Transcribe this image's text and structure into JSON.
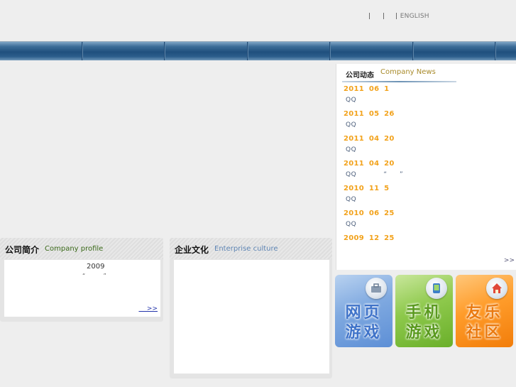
{
  "header": {
    "links": [
      "|",
      "|",
      "|"
    ],
    "english_label": "ENGLISH"
  },
  "nav": {
    "items": 7
  },
  "news": {
    "title_cn": "公司动态",
    "title_en": "Company News",
    "items": [
      {
        "date": "2011  06  1",
        "title": "QQ"
      },
      {
        "date": "2011  05  26",
        "title": "QQ"
      },
      {
        "date": "2011  04  20",
        "title": "QQ"
      },
      {
        "date": "2011  04  20",
        "title": "QQ           “     ”"
      },
      {
        "date": "2010  11  5",
        "title": "QQ"
      },
      {
        "date": "2010  06  25",
        "title": "QQ"
      },
      {
        "date": "2009  12  25",
        "title": ""
      }
    ],
    "more": ">>"
  },
  "tiles": [
    {
      "line1": "网页",
      "line2": "游戏",
      "icon": "briefcase-icon"
    },
    {
      "line1": "手机",
      "line2": "游戏",
      "icon": "phone-icon"
    },
    {
      "line1": "友乐",
      "line2": "社区",
      "icon": "house-icon"
    }
  ],
  "profile": {
    "title_cn": "公司简介",
    "title_en": "Company profile",
    "year": "2009",
    "quote": "“          ”",
    "more": "    >>"
  },
  "culture": {
    "title_cn": "企业文化",
    "title_en": "Enterprise culture"
  }
}
